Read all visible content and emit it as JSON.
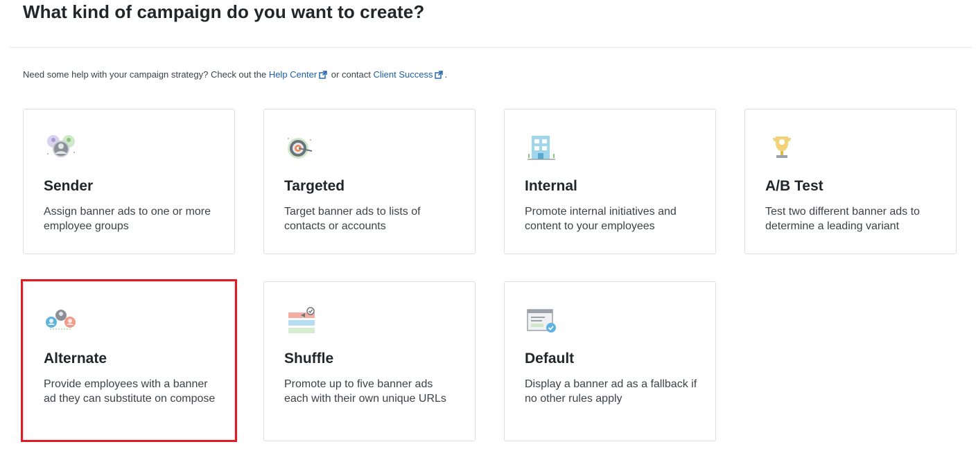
{
  "page": {
    "title": "What kind of campaign do you want to create?"
  },
  "help": {
    "prefix": "Need some help with your campaign strategy? Check out the ",
    "help_center_label": "Help Center",
    "middle": " or contact ",
    "client_success_label": "Client Success",
    "suffix": "."
  },
  "campaign_types": [
    {
      "title": "Sender",
      "description": "Assign banner ads to one or more employee groups",
      "icon": "people-group-icon"
    },
    {
      "title": "Targeted",
      "description": "Target banner ads to lists of contacts or accounts",
      "icon": "target-icon"
    },
    {
      "title": "Internal",
      "description": "Promote internal initiatives and content to your employees",
      "icon": "building-icon"
    },
    {
      "title": "A/B Test",
      "description": "Test two different banner ads to determine a leading variant",
      "icon": "trophy-icon"
    },
    {
      "title": "Alternate",
      "description": "Provide employees with a banner ad they can substitute on compose",
      "icon": "alternate-people-icon"
    },
    {
      "title": "Shuffle",
      "description": "Promote up to five banner ads each with their own unique URLs",
      "icon": "shuffle-banners-icon"
    },
    {
      "title": "Default",
      "description": "Display a banner ad as a fallback if no other rules apply",
      "icon": "default-banner-icon"
    }
  ],
  "colors": {
    "link": "#1b5faa",
    "highlight": "#e11b22",
    "card_border": "#dcdfe2"
  }
}
